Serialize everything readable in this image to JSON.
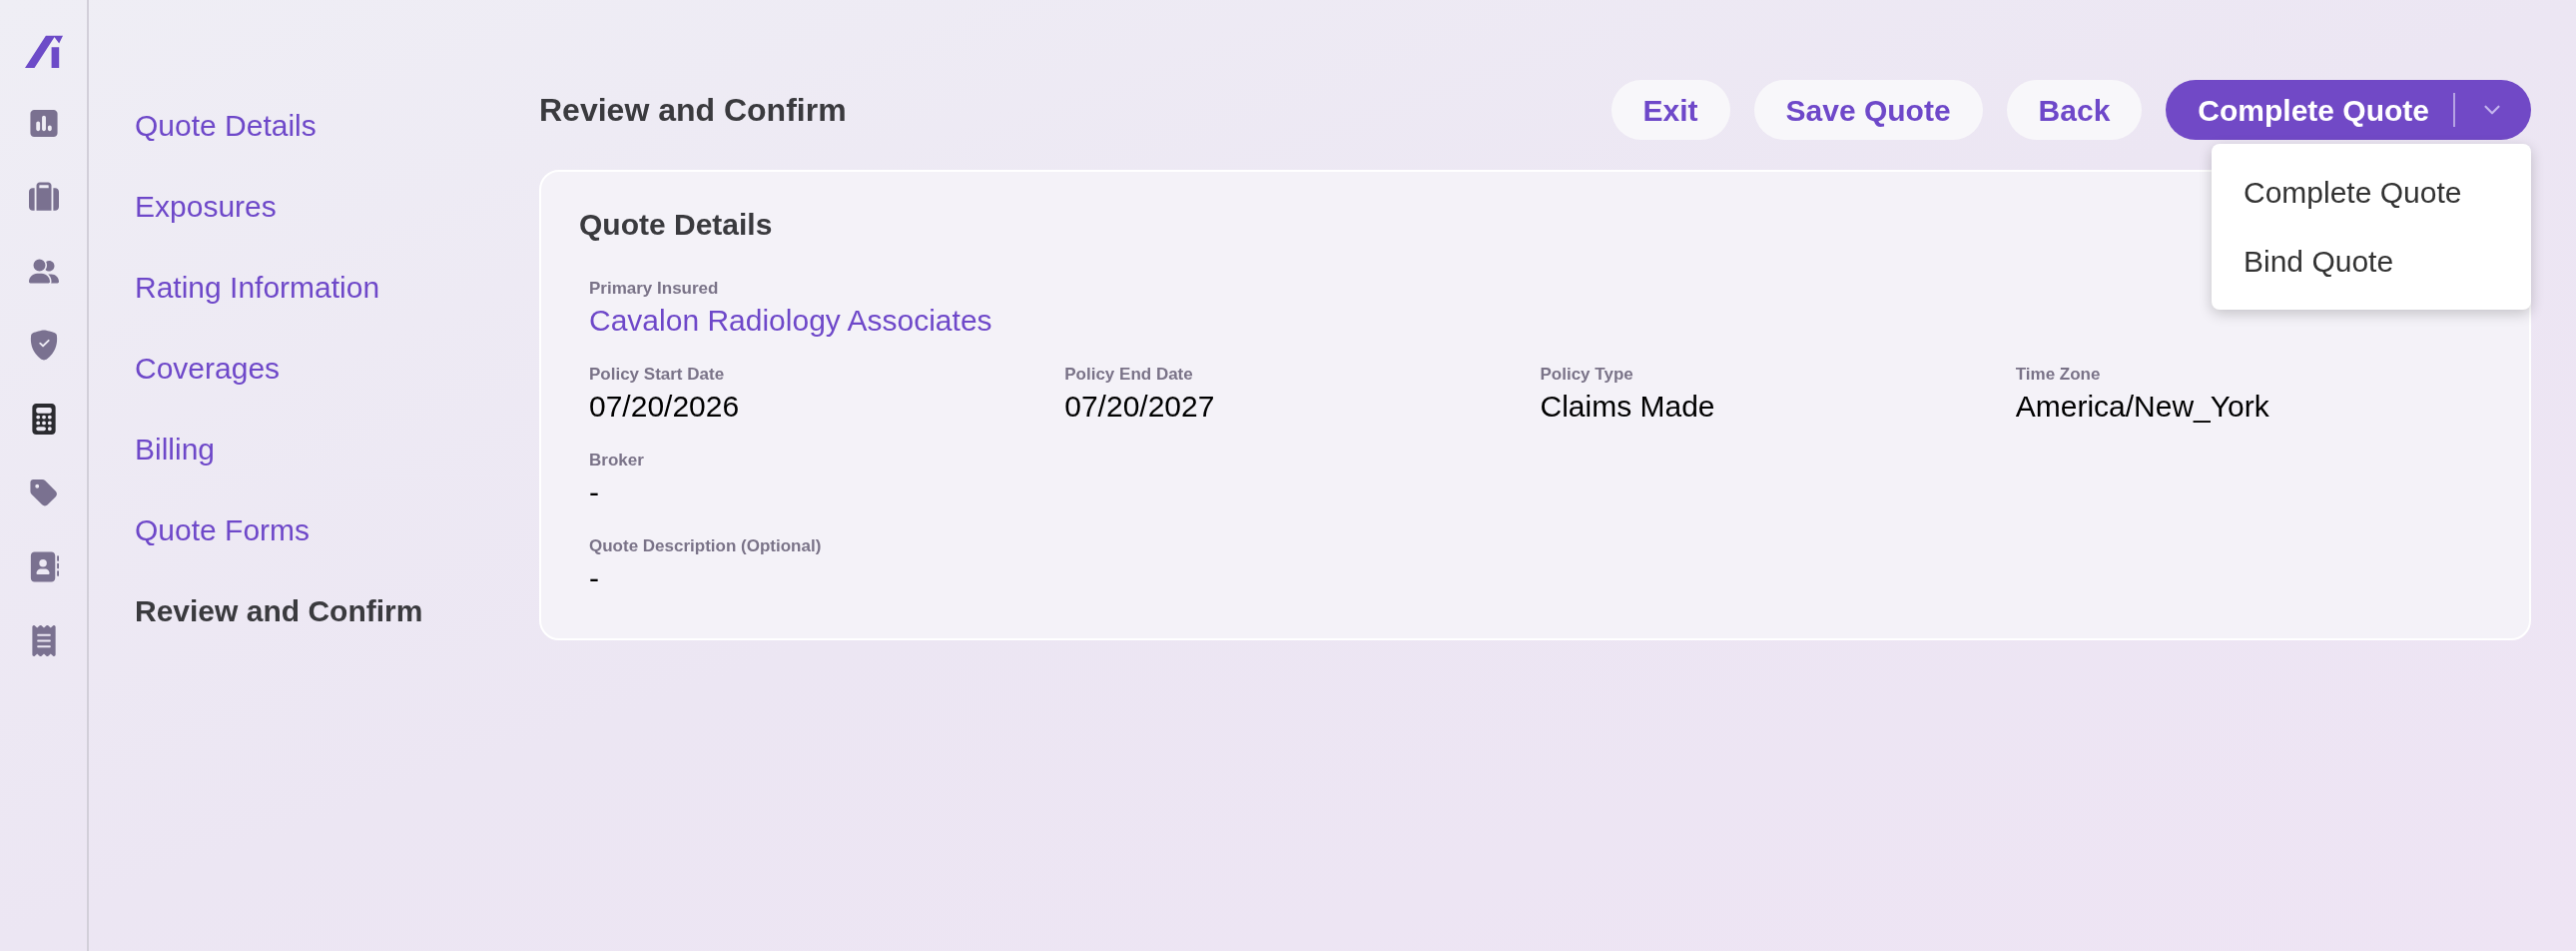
{
  "rail": {
    "items": [
      {
        "kind": "chart",
        "selected": false
      },
      {
        "kind": "briefcase",
        "selected": false
      },
      {
        "kind": "users",
        "selected": false
      },
      {
        "kind": "shield",
        "selected": false
      },
      {
        "kind": "calculator",
        "selected": true
      },
      {
        "kind": "tag",
        "selected": false
      },
      {
        "kind": "contacts",
        "selected": false
      },
      {
        "kind": "receipt",
        "selected": false
      }
    ]
  },
  "nav": {
    "items": [
      {
        "label": "Quote Details",
        "selected": false
      },
      {
        "label": "Exposures",
        "selected": false
      },
      {
        "label": "Rating Information",
        "selected": false
      },
      {
        "label": "Coverages",
        "selected": false
      },
      {
        "label": "Billing",
        "selected": false
      },
      {
        "label": "Quote Forms",
        "selected": false
      },
      {
        "label": "Review and Confirm",
        "selected": true
      }
    ]
  },
  "header": {
    "title": "Review and Confirm",
    "buttons": [
      "Exit",
      "Save Quote",
      "Back"
    ],
    "primary": {
      "label": "Complete Quote",
      "expanded": true,
      "menu": [
        "Complete Quote",
        "Bind Quote"
      ]
    }
  },
  "card": {
    "title": "Quote Details",
    "rows": [
      [
        {
          "label": "Primary Insured",
          "value": "Cavalon Radiology Associates",
          "kind": "link"
        }
      ],
      [
        {
          "label": "Policy Start Date",
          "value": "07/20/2026",
          "kind": "text"
        },
        {
          "label": "Policy End Date",
          "value": "07/20/2027",
          "kind": "text"
        },
        {
          "label": "Policy Type",
          "value": "Claims Made",
          "kind": "text"
        },
        {
          "label": "Time Zone",
          "value": "America/New_York",
          "kind": "text"
        }
      ],
      [
        {
          "label": "Broker",
          "value": "-",
          "kind": "text"
        }
      ],
      [
        {
          "label": "Quote Description (Optional)",
          "value": "-",
          "kind": "text"
        }
      ]
    ]
  }
}
